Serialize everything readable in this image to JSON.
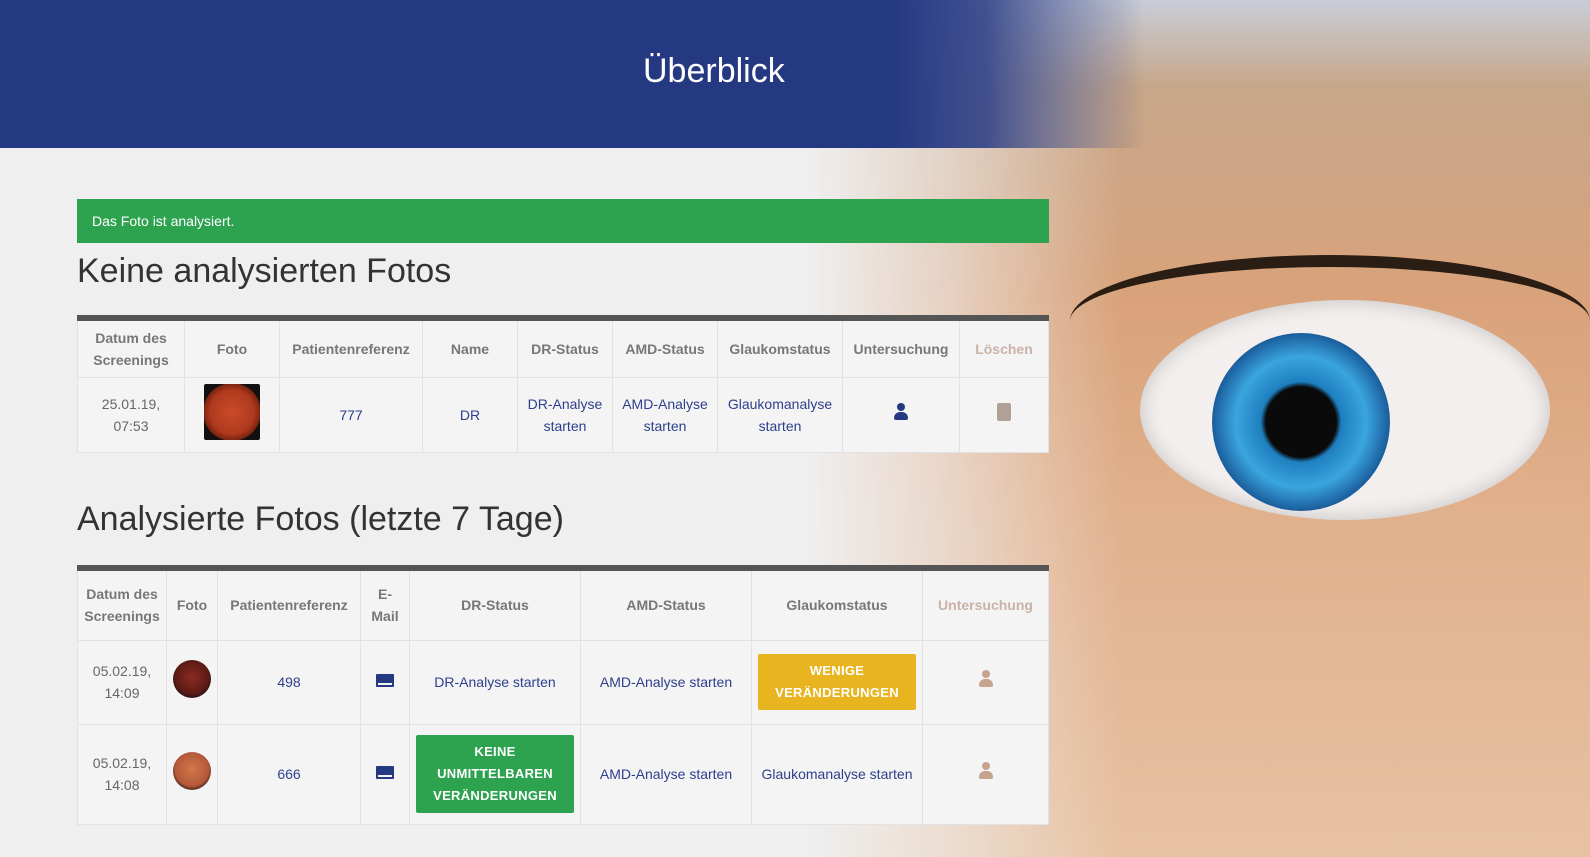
{
  "header": {
    "title": "Überblick"
  },
  "alert": {
    "text": "Das Foto ist analysiert."
  },
  "section1": {
    "title": "Keine analysierten Fotos",
    "columns": [
      "Datum des Screenings",
      "Foto",
      "Patientenreferenz",
      "Name",
      "DR-Status",
      "AMD-Status",
      "Glaukomstatus",
      "Untersuchung",
      "Löschen"
    ],
    "rows": [
      {
        "date": "25.01.19,",
        "time": "07:53",
        "ref": "777",
        "name": "DR",
        "dr": "DR-Analyse starten",
        "amd": "AMD-Analyse starten",
        "glaukom": "Glaukomanalyse starten"
      }
    ]
  },
  "section2": {
    "title": "Analysierte Fotos (letzte 7 Tage)",
    "columns": [
      "Datum des Screenings",
      "Foto",
      "Patientenreferenz",
      "E-Mail",
      "DR-Status",
      "AMD-Status",
      "Glaukomstatus",
      "Untersuchung"
    ],
    "rows": [
      {
        "date": "05.02.19,",
        "time": "14:09",
        "ref": "498",
        "dr": "DR-Analyse starten",
        "amd": "AMD-Analyse starten",
        "glaukom_badge": "WENIGE VERÄNDERUNGEN"
      },
      {
        "date": "05.02.19,",
        "time": "14:08",
        "ref": "666",
        "dr_badge": "KEINE UNMITTELBAREN VERÄNDERUNGEN",
        "amd": "AMD-Analyse starten",
        "glaukom": "Glaukomanalyse starten"
      }
    ]
  },
  "colors": {
    "header": "#253983",
    "success": "#2ea34f",
    "warning": "#e8b41f"
  }
}
